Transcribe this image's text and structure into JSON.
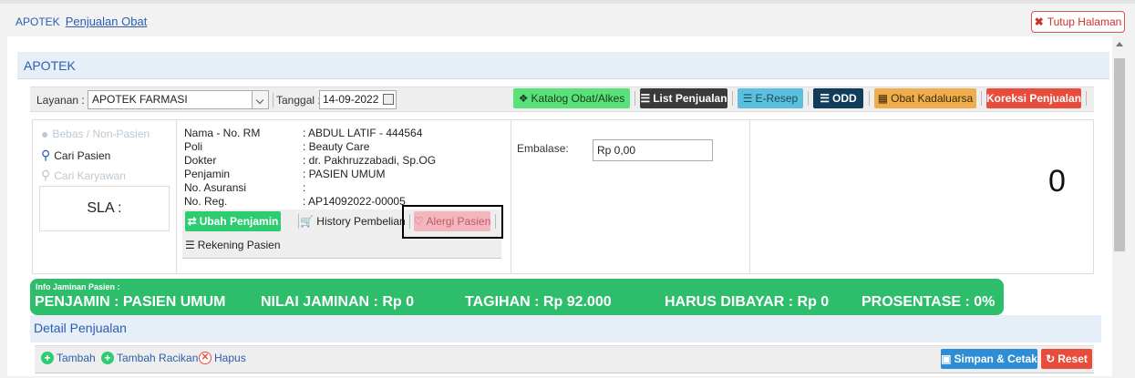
{
  "breadcrumb": {
    "root": "APOTEK",
    "current": "Penjualan Obat"
  },
  "close_button": "Tutup Halaman",
  "panel_title": "APOTEK",
  "toolbar": {
    "layanan_label": "Layanan :",
    "layanan_value": "APOTEK FARMASI",
    "tanggal_label": "Tanggal :",
    "tanggal_value": "14-09-2022",
    "buttons": {
      "katalog": "Katalog Obat/Alkes",
      "list_penjualan": "List Penjualan",
      "eresep": "E-Resep",
      "odd": "ODD",
      "kadaluarsa": "Obat Kadaluarsa",
      "koreksi": "Koreksi Penjualan"
    }
  },
  "sidebar": {
    "bebas": "Bebas / Non-Pasien",
    "cari_pasien": "Cari Pasien",
    "cari_karyawan": "Cari Karyawan",
    "sla": "SLA :"
  },
  "patient": {
    "rows": [
      {
        "k": "Nama - No. RM",
        "v": ": ABDUL LATIF - 444564"
      },
      {
        "k": "Poli",
        "v": ": Beauty Care"
      },
      {
        "k": "Dokter",
        "v": ": dr. Pakhruzzabadi, Sp.OG"
      },
      {
        "k": "Penjamin",
        "v": ": PASIEN UMUM"
      },
      {
        "k": "No. Asuransi",
        "v": ":"
      },
      {
        "k": "No. Reg.",
        "v": ": AP14092022-00005"
      }
    ],
    "ubah_penjamin": "Ubah Penjamin",
    "history": "History Pembelian",
    "alergi": "Alergi Pasien",
    "rekening": "Rekening Pasien"
  },
  "embalase": {
    "label": "Embalase:",
    "value": "Rp 0,00"
  },
  "total": "0",
  "jaminan": {
    "title": "Info Jaminan Pasien :",
    "penjamin": "PENJAMIN : PASIEN UMUM",
    "nilai": "NILAI JAMINAN : Rp 0",
    "tagihan": "TAGIHAN : Rp 92.000",
    "harus": "HARUS DIBAYAR : Rp 0",
    "prosentase": "PROSENTASE : 0%"
  },
  "detail": {
    "title": "Detail Penjualan",
    "tambah": "Tambah",
    "tambah_racikan": "Tambah Racikan",
    "hapus": "Hapus",
    "simpan": "Simpan & Cetak",
    "reset": "Reset"
  },
  "colors": {
    "accent": "#2a5db0",
    "success": "#2ebd6b",
    "danger": "#e74c3c"
  }
}
